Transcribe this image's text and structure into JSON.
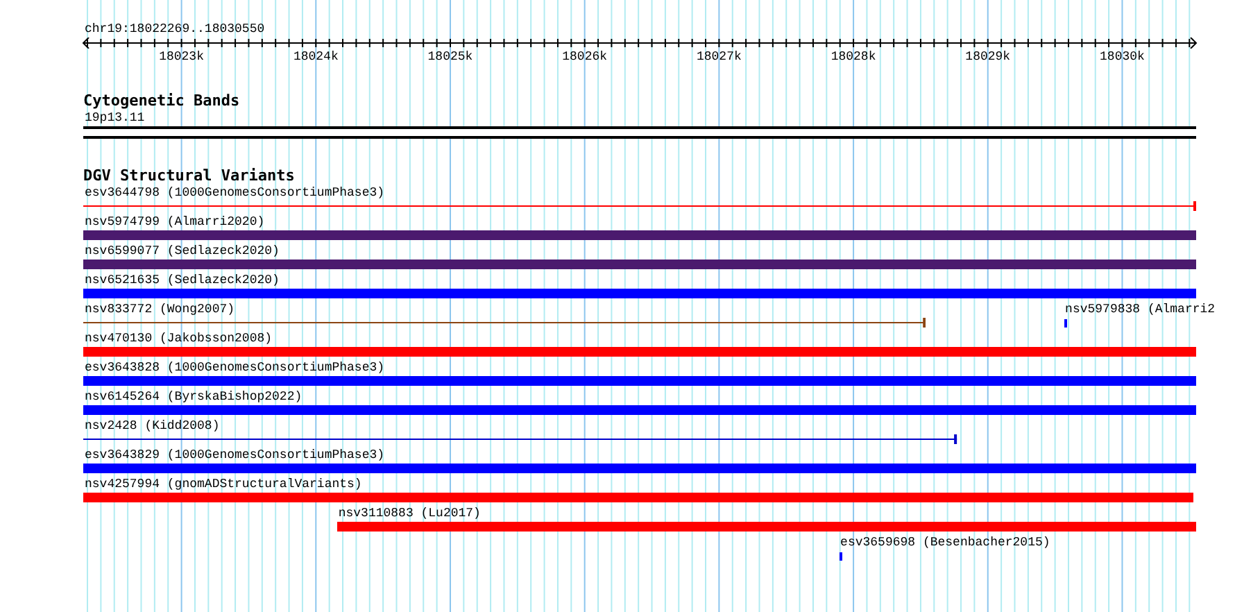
{
  "ruler": {
    "location": "chr19:18022269..18030550",
    "ticks": [
      "18023k",
      "18024k",
      "18025k",
      "18026k",
      "18027k",
      "18028k",
      "18029k",
      "18030k"
    ]
  },
  "tracks": [
    {
      "title": "Cytogenetic Bands",
      "kind": "cytoband",
      "features": [
        {
          "label": "19p13.11"
        }
      ]
    },
    {
      "title": "DGV Structural Variants",
      "kind": "variants",
      "rows": [
        {
          "features": [
            {
              "label": "esv3644798 (1000GenomesConsortiumPhase3)",
              "kind": "thin",
              "color": "#ff0000"
            }
          ]
        },
        {
          "features": [
            {
              "label": "nsv5974799 (Almarri2020)",
              "kind": "bar",
              "color": "#4b1a6e"
            }
          ]
        },
        {
          "features": [
            {
              "label": "nsv6599077 (Sedlazeck2020)",
              "kind": "bar",
              "color": "#4b1a6e"
            }
          ]
        },
        {
          "features": [
            {
              "label": "nsv6521635 (Sedlazeck2020)",
              "kind": "bar",
              "color": "#0000ff"
            }
          ]
        },
        {
          "features": [
            {
              "label": "nsv833772 (Wong2007)",
              "kind": "thin",
              "color": "#8b4513"
            },
            {
              "label": "nsv5979838 (Almarri2",
              "kind": "tick",
              "color": "#0000ff"
            }
          ]
        },
        {
          "features": [
            {
              "label": "nsv470130 (Jakobsson2008)",
              "kind": "bar",
              "color": "#ff0000"
            }
          ]
        },
        {
          "features": [
            {
              "label": "esv3643828 (1000GenomesConsortiumPhase3)",
              "kind": "bar",
              "color": "#0000ff"
            }
          ]
        },
        {
          "features": [
            {
              "label": "nsv6145264 (ByrskaBishop2022)",
              "kind": "bar",
              "color": "#0000ff"
            }
          ]
        },
        {
          "features": [
            {
              "label": "nsv2428 (Kidd2008)",
              "kind": "thin",
              "color": "#0000cc"
            }
          ]
        },
        {
          "features": [
            {
              "label": "esv3643829 (1000GenomesConsortiumPhase3)",
              "kind": "bar",
              "color": "#0000ff"
            }
          ]
        },
        {
          "features": [
            {
              "label": "nsv4257994 (gnomADStructuralVariants)",
              "kind": "bar",
              "color": "#ff0000"
            }
          ]
        },
        {
          "features": [
            {
              "label": "nsv3110883 (Lu2017)",
              "kind": "bar",
              "color": "#ff0000"
            }
          ]
        },
        {
          "features": [
            {
              "label": "esv3659698 (Besenbacher2015)",
              "kind": "tick",
              "color": "#0000ff"
            }
          ]
        }
      ]
    }
  ]
}
